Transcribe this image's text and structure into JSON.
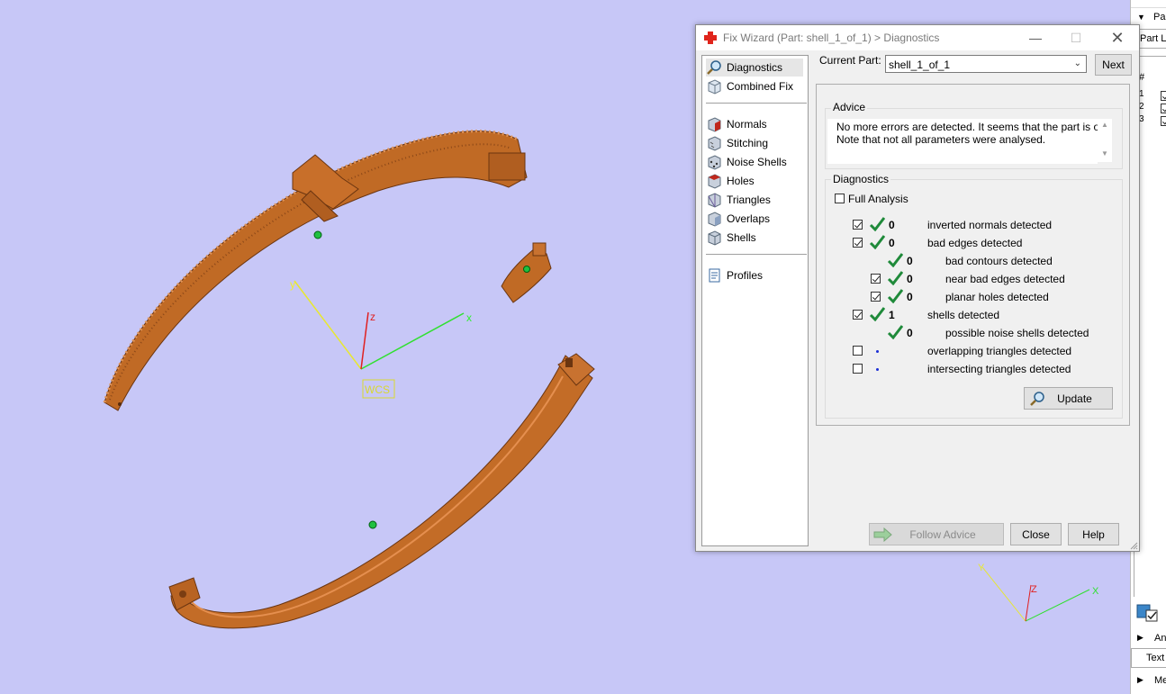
{
  "viewport": {
    "background": "#c7c7f7",
    "wcs_label": "WCS",
    "axes": {
      "x": "x",
      "y": "y",
      "z": "z"
    },
    "mini_axes": {
      "x": "X",
      "y": "Y",
      "z": "Z"
    },
    "part_color": "#c8702a"
  },
  "dialog": {
    "title": "Fix Wizard (Part: shell_1_of_1) > Diagnostics",
    "current_part_label": "Current Part:",
    "current_part_value": "shell_1_of_1",
    "next_label": "Next",
    "nav": [
      {
        "label": "Diagnostics",
        "icon": "magnifier-icon",
        "selected": true
      },
      {
        "label": "Combined Fix",
        "icon": "cube-icon"
      },
      {
        "label": "Normals",
        "icon": "normals-cube-icon"
      },
      {
        "label": "Stitching",
        "icon": "stitching-cube-icon"
      },
      {
        "label": "Noise Shells",
        "icon": "noise-shells-icon"
      },
      {
        "label": "Holes",
        "icon": "holes-cube-icon"
      },
      {
        "label": "Triangles",
        "icon": "triangles-cube-icon"
      },
      {
        "label": "Overlaps",
        "icon": "overlaps-cube-icon"
      },
      {
        "label": "Shells",
        "icon": "shells-cube-icon"
      },
      {
        "label": "Profiles",
        "icon": "document-icon"
      }
    ],
    "advice": {
      "heading": "Advice",
      "line1": "No more errors are detected. It seems that the part is ok.",
      "line2": "Note that not all parameters were analysed."
    },
    "diagnostics": {
      "heading": "Diagnostics",
      "full_analysis_label": "Full Analysis",
      "rows": [
        {
          "count": "0",
          "label": "inverted normals detected",
          "checked": true
        },
        {
          "count": "0",
          "label": "bad edges detected",
          "checked": true
        },
        {
          "count": "0",
          "label": "bad contours detected"
        },
        {
          "count": "0",
          "label": "near bad edges detected",
          "checked": true
        },
        {
          "count": "0",
          "label": "planar holes detected",
          "checked": true
        },
        {
          "count": "1",
          "label": "shells detected",
          "checked": true
        },
        {
          "count": "0",
          "label": "possible noise shells detected"
        },
        {
          "count": "",
          "label": "overlapping triangles detected",
          "checked": false
        },
        {
          "count": "",
          "label": "intersecting triangles detected",
          "checked": false
        }
      ],
      "update_label": "Update"
    },
    "follow_advice_label": "Follow Advice",
    "close_label": "Close",
    "help_label": "Help"
  },
  "right_panel": {
    "header1": "Pa",
    "part_list_label": "Part L",
    "hash": "#",
    "rows": [
      "1",
      "2",
      "3"
    ],
    "an_label": "An",
    "text_label": "Text",
    "me_label": "Me"
  }
}
